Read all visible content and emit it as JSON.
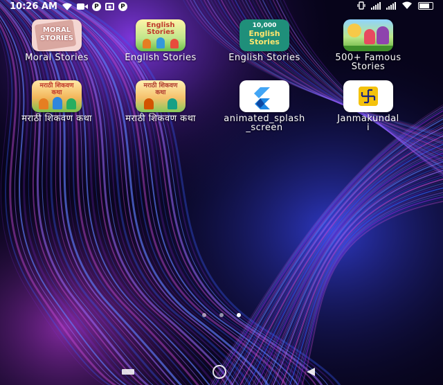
{
  "status_bar": {
    "time": "10:26 AM",
    "left_icons": [
      "wifi-icon",
      "video-call-icon",
      "parking-p-icon",
      "screen-record-icon",
      "parking-p-icon"
    ],
    "right_icons": [
      "vibrate-icon",
      "signal-icon",
      "signal-icon",
      "wifi-icon",
      "battery-icon"
    ],
    "battery_level": 0.85
  },
  "apps": [
    {
      "label": "Moral Stories",
      "icon_text": [
        "MORAL",
        "STORIES"
      ],
      "icon": "moral-stories-book-icon"
    },
    {
      "label": "English Stories",
      "icon_text": [
        "English",
        "Stories"
      ],
      "icon": "english-stories-kids-icon"
    },
    {
      "label": "English Stories",
      "icon_text": [
        "10,000",
        "English",
        "Stories"
      ],
      "icon": "english-stories-teal-icon"
    },
    {
      "label": "500+ Famous Stories",
      "icon_text": [],
      "icon": "famous-stories-cartoon-icon"
    },
    {
      "label": "मराठी शिकवण कथा",
      "icon_text": [
        "मराठी शिकवण",
        "कथा"
      ],
      "icon": "marathi-stories-icon"
    },
    {
      "label": "मराठी शिकवण कथा",
      "icon_text": [
        "मराठी शिकवण",
        "कथा"
      ],
      "icon": "marathi-stories-2-icon"
    },
    {
      "label": "animated_splash_screen",
      "icon_text": [],
      "icon": "flutter-logo-icon"
    },
    {
      "label": "Janmakundali",
      "icon_text": [],
      "icon": "janmakundali-swastik-icon"
    }
  ],
  "page_indicator": {
    "count": 3,
    "active": 2
  },
  "nav_bar": {
    "buttons": [
      "recents-button",
      "home-button",
      "back-button"
    ]
  },
  "colors": {
    "wallpaper_base": "#07041a",
    "wallpaper_streak_purple": "#7a2bd6",
    "wallpaper_streak_blue": "#3a5cff",
    "wallpaper_streak_magenta": "#c64bd9"
  }
}
